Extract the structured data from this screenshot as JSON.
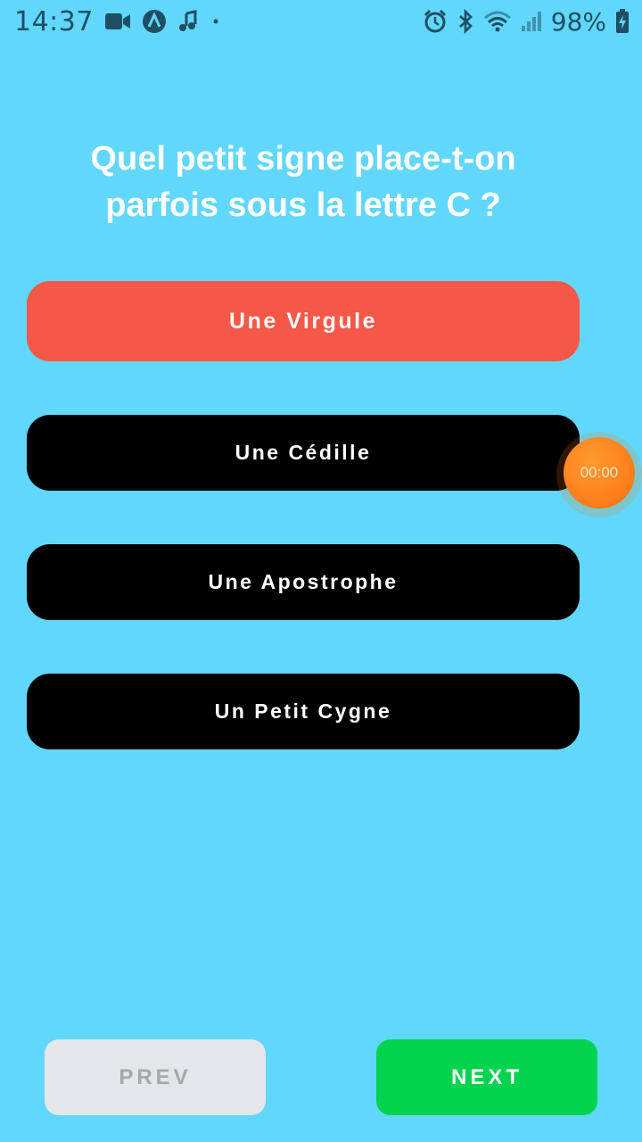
{
  "status_bar": {
    "time": "14:37",
    "battery_percent": "98%",
    "left_icons": [
      "video-camera-icon",
      "app-notification-icon",
      "music-notification-icon",
      "dot-icon"
    ],
    "right_icons": [
      "alarm-icon",
      "bluetooth-icon",
      "wifi-icon",
      "signal-icon",
      "battery-charging-icon"
    ]
  },
  "question": {
    "line1": "Quel petit signe place-t-on",
    "line2": "parfois sous la lettre C ?"
  },
  "answers": [
    {
      "label": "Une Virgule",
      "state": "selected-wrong"
    },
    {
      "label": "Une Cédille",
      "state": "default"
    },
    {
      "label": "Une Apostrophe",
      "state": "default"
    },
    {
      "label": "Un Petit Cygne",
      "state": "default"
    }
  ],
  "timer": {
    "value": "00:00"
  },
  "nav": {
    "prev_label": "PREV",
    "next_label": "NEXT"
  },
  "colors": {
    "background": "#61d7fb",
    "wrong_answer": "#f65847",
    "answer_default": "#000000",
    "next_button": "#00d34e",
    "prev_button_disabled": "#e3e6ea",
    "timer": "#ff7a1a"
  }
}
